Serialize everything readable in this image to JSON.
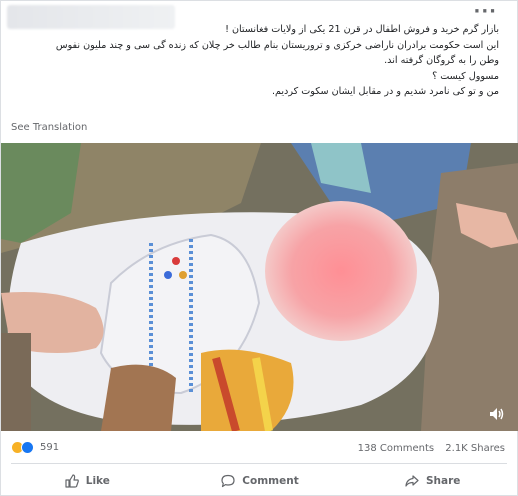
{
  "post": {
    "text_lines": [
      "بازار گرم خرید و فروش اطفال در قرن 21 یکی از ولایات فغانستان !",
      "این است حکومت برادران ناراضی خرکزی و تروریستان بنام طالب خر چلان که زنده گی سی و چند ملیون نفوس",
      "وطن را به گروگان گرفته اند.",
      "مسوول کیست ؟",
      "من و تو کی نامرد شدیم و در مقابل ایشان سکوت کردیم."
    ],
    "see_translation": "See Translation",
    "more_icon": "more-options-icon"
  },
  "media": {
    "volume_icon": "volume-icon"
  },
  "stats": {
    "reaction_count": "591",
    "comments": "138 Comments",
    "shares": "2.1K Shares"
  },
  "actions": {
    "like": "Like",
    "comment": "Comment",
    "share": "Share"
  }
}
